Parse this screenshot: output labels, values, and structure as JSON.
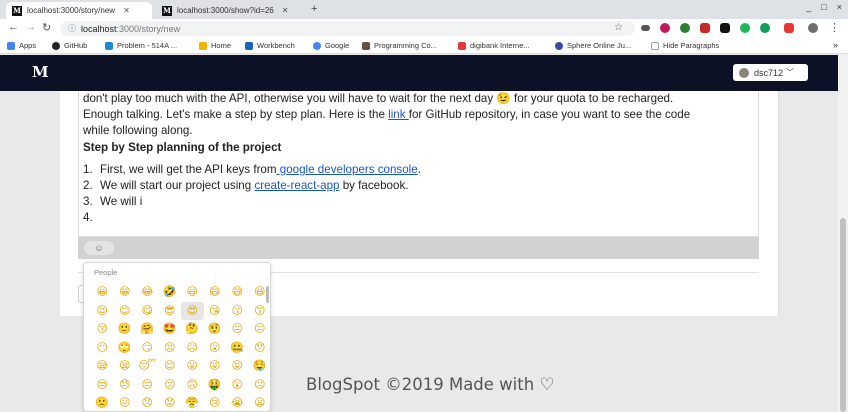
{
  "browser": {
    "tabs": [
      {
        "title": "localhost:3000/story/new",
        "favicon": "M",
        "active": true
      },
      {
        "title": "localhost:3000/show?id=26",
        "favicon": "M",
        "active": false
      }
    ],
    "new_tab": "+",
    "url_host": "localhost",
    "url_path": ":3000/story/new",
    "window_controls": {
      "minimize": "_",
      "maximize": "□",
      "close": "×"
    },
    "bookmarks": [
      {
        "label": "Apps",
        "color": "#4285f4"
      },
      {
        "label": "GitHub",
        "color": "#222222"
      },
      {
        "label": "Problem - 514A ...",
        "color": "#1f8acb"
      },
      {
        "label": "Home",
        "color": "#f4b400"
      },
      {
        "label": "Workbench",
        "color": "#1565c0"
      },
      {
        "label": "Google",
        "color": "#4285f4"
      },
      {
        "label": "Programming Co...",
        "color": "#6d4c41"
      },
      {
        "label": "digibank Interne...",
        "color": "#e53935"
      },
      {
        "label": "Sphere Online Ju...",
        "color": "#3949ab"
      },
      {
        "label": "Hide Paragraphs",
        "color": "#9e9e9e"
      }
    ],
    "bookmarks_more": "»"
  },
  "site": {
    "logo": "M",
    "username": "dsc712"
  },
  "editor": {
    "line1_a": "don't play too much with the API, otherwise you will have to wait for the next day ",
    "line1_emoji": "😉",
    "line1_b": " for your quota to be recharged.",
    "line2_a": "Enough talking. Let's make a step by step plan. Here is the ",
    "line2_link": "link ",
    "line2_b": "for GitHub repository, in case you want to see the code",
    "line3": "while following along.",
    "heading": "Step by Step planning of the project",
    "list": [
      {
        "num": "1.",
        "a": "First, we will get the API keys from",
        "link": " google developers console",
        "b": "."
      },
      {
        "num": "2.",
        "a": "We will start our project using ",
        "link": "create-react-app",
        "b": " by facebook."
      },
      {
        "num": "3.",
        "a": "We will i",
        "link": "",
        "b": ""
      },
      {
        "num": "4.",
        "a": "",
        "link": "",
        "b": ""
      }
    ]
  },
  "emoji_button": "☺",
  "picker": {
    "category": "People",
    "emojis": [
      "😀",
      "😁",
      "😂",
      "🤣",
      "😃",
      "😄",
      "😅",
      "😆",
      "😉",
      "😊",
      "😋",
      "😎",
      "😍",
      "😘",
      "😗",
      "😙",
      "😚",
      "🙂",
      "🤗",
      "🤩",
      "🤔",
      "🤨",
      "😐",
      "😑",
      "😶",
      "🙄",
      "😏",
      "😣",
      "😥",
      "😮",
      "🤐",
      "😯",
      "😪",
      "😫",
      "😴",
      "😌",
      "😛",
      "😜",
      "😝",
      "🤤",
      "😒",
      "😓",
      "😔",
      "😕",
      "🙃",
      "🤑",
      "😲",
      "☹",
      "🙁",
      "😖",
      "😞",
      "😟",
      "😤",
      "😢",
      "😭",
      "😦"
    ],
    "selected_index": 12
  },
  "footer": {
    "text": "BlogSpot ©2019 Made with ",
    "heart": "♡"
  },
  "colors": {
    "header_bg": "#0c1126",
    "link": "#1a55c9",
    "emoji_bar": "#d2d2d2"
  }
}
